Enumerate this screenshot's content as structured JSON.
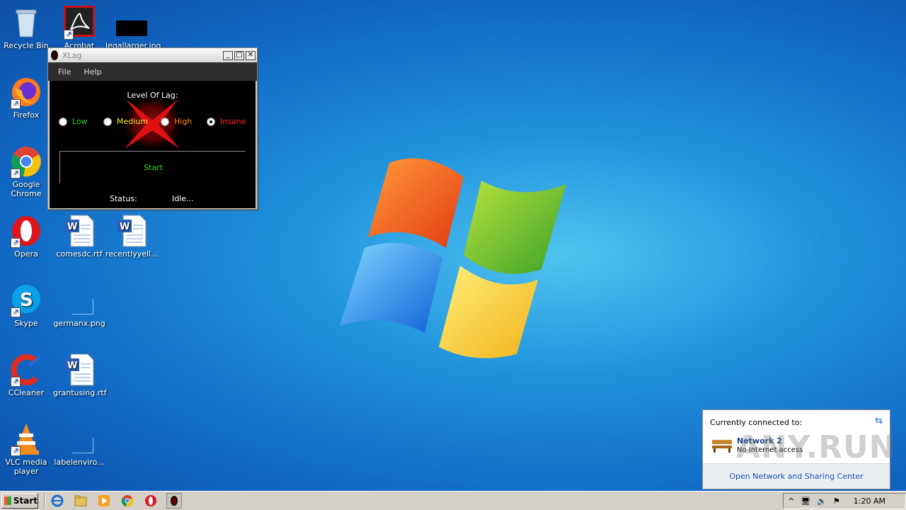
{
  "desktop": {
    "icons": [
      {
        "label": "Recycle Bin",
        "icon": "recycle-bin-icon"
      },
      {
        "label": "Acrobat",
        "icon": "acrobat-icon"
      },
      {
        "label": "legallarger.jpg",
        "icon": "image-file-icon"
      },
      {
        "label": "Firefox",
        "icon": "firefox-icon"
      },
      {
        "label": "Google Chrome",
        "icon": "chrome-icon"
      },
      {
        "label": "Opera",
        "icon": "opera-icon"
      },
      {
        "label": "comesdc.rtf",
        "icon": "word-document-icon"
      },
      {
        "label": "recentlyyell...",
        "icon": "word-document-icon"
      },
      {
        "label": "Skype",
        "icon": "skype-icon"
      },
      {
        "label": "germanx.png",
        "icon": "image-file-icon"
      },
      {
        "label": "CCleaner",
        "icon": "ccleaner-icon"
      },
      {
        "label": "grantusing.rtf",
        "icon": "word-document-icon"
      },
      {
        "label": "VLC media player",
        "icon": "vlc-icon"
      },
      {
        "label": "labelenviro...",
        "icon": "image-file-icon"
      }
    ]
  },
  "xlag": {
    "title": "XLag",
    "menu": {
      "file": "File",
      "help": "Help"
    },
    "level_label": "Level Of Lag:",
    "options": [
      {
        "label": "Low",
        "color": "#22dd22",
        "selected": false
      },
      {
        "label": "Medium",
        "color": "#e8e830",
        "selected": false
      },
      {
        "label": "High",
        "color": "#ff8c1a",
        "selected": false
      },
      {
        "label": "Insane",
        "color": "#ff2020",
        "selected": true
      }
    ],
    "start_label": "Start",
    "status_label": "Status:",
    "status_value": "Idle..."
  },
  "network_popup": {
    "header": "Currently connected to:",
    "network_name": "Network  2",
    "network_status": "No Internet access",
    "link": "Open Network and Sharing Center"
  },
  "watermark": "ANY.RUN",
  "taskbar": {
    "start_label": "Start",
    "pinned": [
      "internet-explorer-icon",
      "explorer-icon",
      "media-player-icon",
      "chrome-icon",
      "opera-icon",
      "xlag-icon"
    ],
    "tray": {
      "show_hidden": "^",
      "clock": "1:20 AM"
    }
  },
  "colors": {
    "desktop_blue": "#1e90dc",
    "xlag_bg": "#000000",
    "menubar": "#2e2e2e"
  }
}
